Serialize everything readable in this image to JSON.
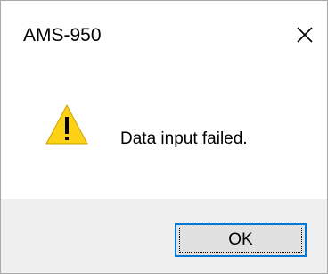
{
  "window": {
    "title": "AMS-950",
    "close_icon": "close-icon"
  },
  "content": {
    "icon": "warning-icon",
    "message": "Data input failed."
  },
  "buttons": {
    "ok_label": "OK"
  },
  "colors": {
    "warning_fill": "#fcd116",
    "accent": "#0078d7",
    "footer_bg": "#f0f0f0",
    "button_bg": "#e1e1e1"
  }
}
